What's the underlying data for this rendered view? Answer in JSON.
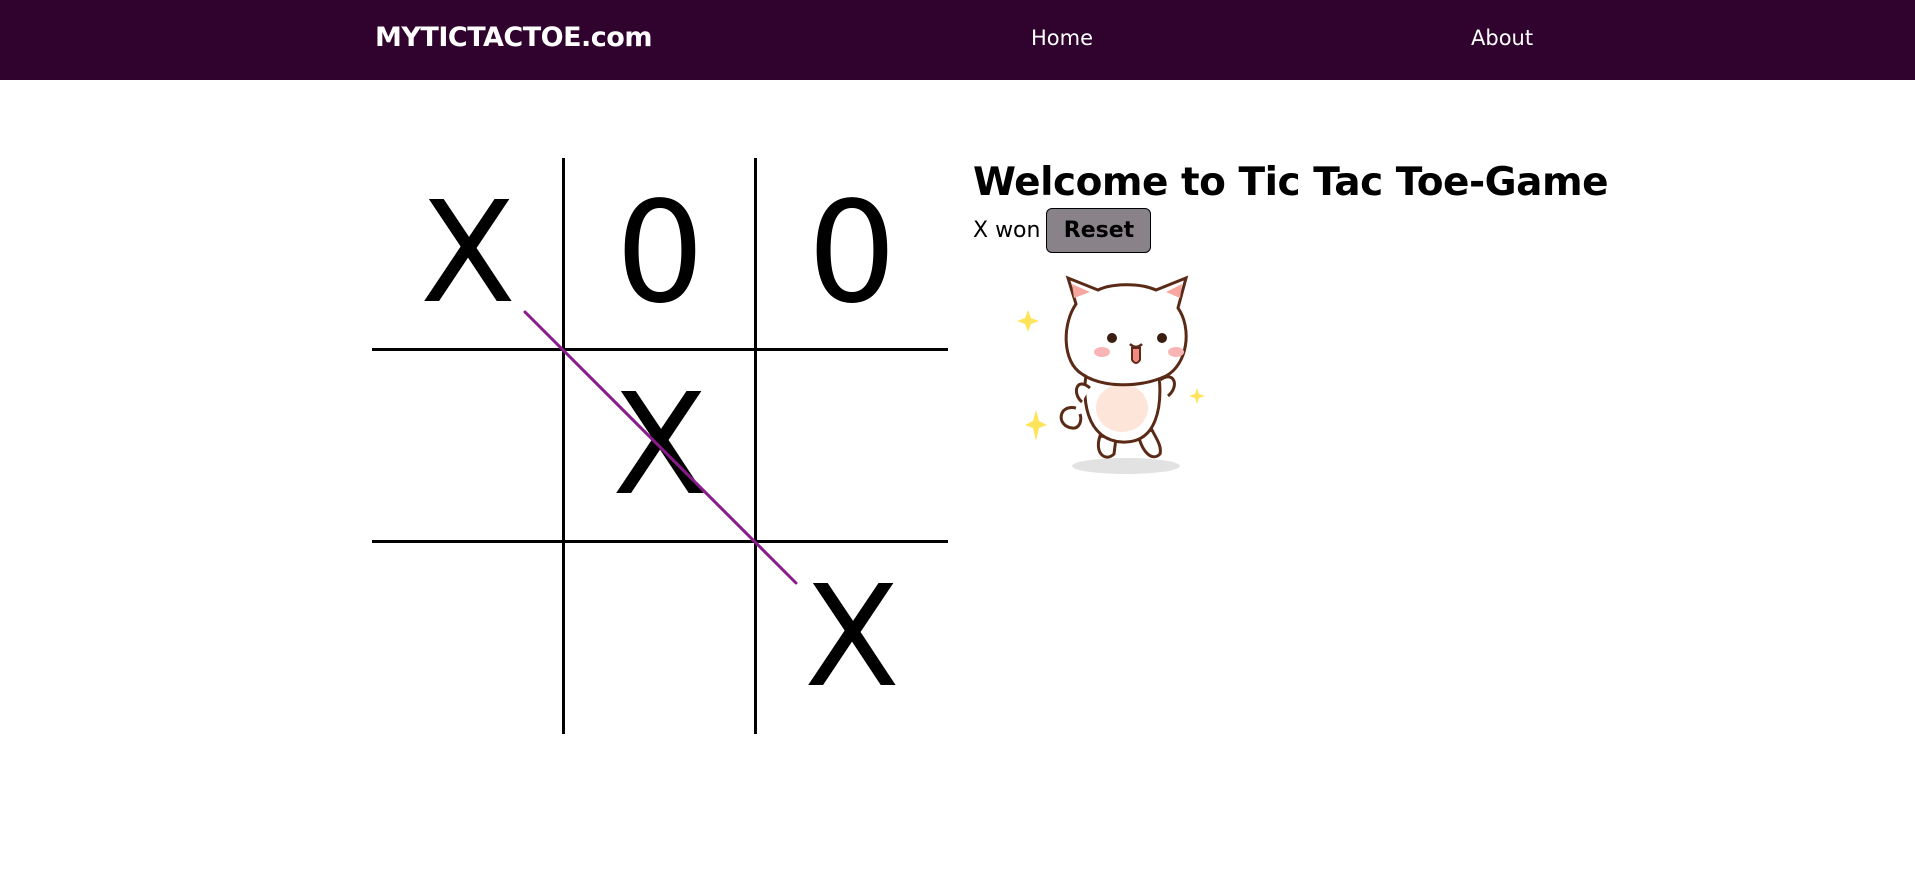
{
  "navbar": {
    "brand": "MYTICTACTOE.com",
    "links": [
      "Home",
      "About"
    ],
    "background": "#2f032e"
  },
  "game": {
    "title": "Welcome to Tic Tac Toe-Game",
    "status": "X won",
    "reset_label": "Reset",
    "board": [
      "X",
      "0",
      "0",
      "",
      "X",
      "",
      "",
      "",
      "X"
    ],
    "winning_line": "diagonal top-left to bottom-right",
    "win_line_color": "#8b1a8b"
  },
  "celebration": {
    "icon": "dancing-cat-sticker"
  }
}
